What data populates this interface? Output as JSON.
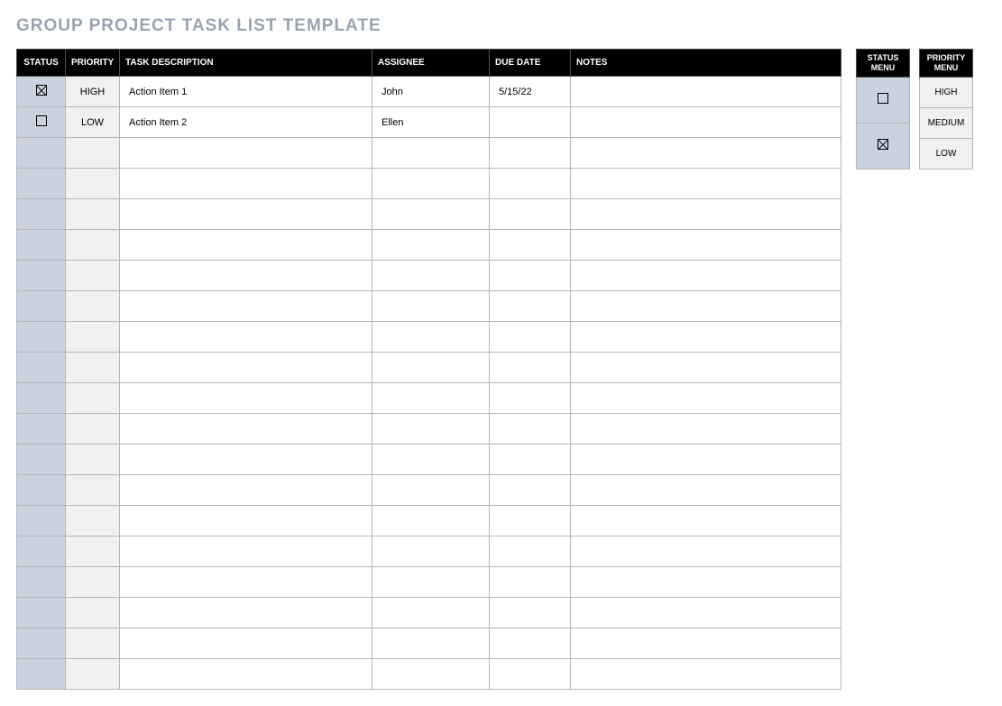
{
  "title": "GROUP PROJECT TASK LIST TEMPLATE",
  "columns": {
    "status": "STATUS",
    "priority": "PRIORITY",
    "task": "TASK DESCRIPTION",
    "assignee": "ASSIGNEE",
    "due": "DUE DATE",
    "notes": "NOTES"
  },
  "rows": [
    {
      "status_checked": true,
      "priority": "HIGH",
      "task": "Action Item 1",
      "assignee": "John",
      "due": "5/15/22",
      "notes": ""
    },
    {
      "status_checked": false,
      "priority": "LOW",
      "task": "Action Item 2",
      "assignee": "Ellen",
      "due": "",
      "notes": ""
    },
    {
      "status_checked": null,
      "priority": "",
      "task": "",
      "assignee": "",
      "due": "",
      "notes": ""
    },
    {
      "status_checked": null,
      "priority": "",
      "task": "",
      "assignee": "",
      "due": "",
      "notes": ""
    },
    {
      "status_checked": null,
      "priority": "",
      "task": "",
      "assignee": "",
      "due": "",
      "notes": ""
    },
    {
      "status_checked": null,
      "priority": "",
      "task": "",
      "assignee": "",
      "due": "",
      "notes": ""
    },
    {
      "status_checked": null,
      "priority": "",
      "task": "",
      "assignee": "",
      "due": "",
      "notes": ""
    },
    {
      "status_checked": null,
      "priority": "",
      "task": "",
      "assignee": "",
      "due": "",
      "notes": ""
    },
    {
      "status_checked": null,
      "priority": "",
      "task": "",
      "assignee": "",
      "due": "",
      "notes": ""
    },
    {
      "status_checked": null,
      "priority": "",
      "task": "",
      "assignee": "",
      "due": "",
      "notes": ""
    },
    {
      "status_checked": null,
      "priority": "",
      "task": "",
      "assignee": "",
      "due": "",
      "notes": ""
    },
    {
      "status_checked": null,
      "priority": "",
      "task": "",
      "assignee": "",
      "due": "",
      "notes": ""
    },
    {
      "status_checked": null,
      "priority": "",
      "task": "",
      "assignee": "",
      "due": "",
      "notes": ""
    },
    {
      "status_checked": null,
      "priority": "",
      "task": "",
      "assignee": "",
      "due": "",
      "notes": ""
    },
    {
      "status_checked": null,
      "priority": "",
      "task": "",
      "assignee": "",
      "due": "",
      "notes": ""
    },
    {
      "status_checked": null,
      "priority": "",
      "task": "",
      "assignee": "",
      "due": "",
      "notes": ""
    },
    {
      "status_checked": null,
      "priority": "",
      "task": "",
      "assignee": "",
      "due": "",
      "notes": ""
    },
    {
      "status_checked": null,
      "priority": "",
      "task": "",
      "assignee": "",
      "due": "",
      "notes": ""
    },
    {
      "status_checked": null,
      "priority": "",
      "task": "",
      "assignee": "",
      "due": "",
      "notes": ""
    },
    {
      "status_checked": null,
      "priority": "",
      "task": "",
      "assignee": "",
      "due": "",
      "notes": ""
    }
  ],
  "status_menu": {
    "header": "STATUS MENU",
    "items": [
      {
        "checked": false
      },
      {
        "checked": true
      }
    ]
  },
  "priority_menu": {
    "header": "PRIORITY MENU",
    "items": [
      "HIGH",
      "MEDIUM",
      "LOW"
    ]
  }
}
